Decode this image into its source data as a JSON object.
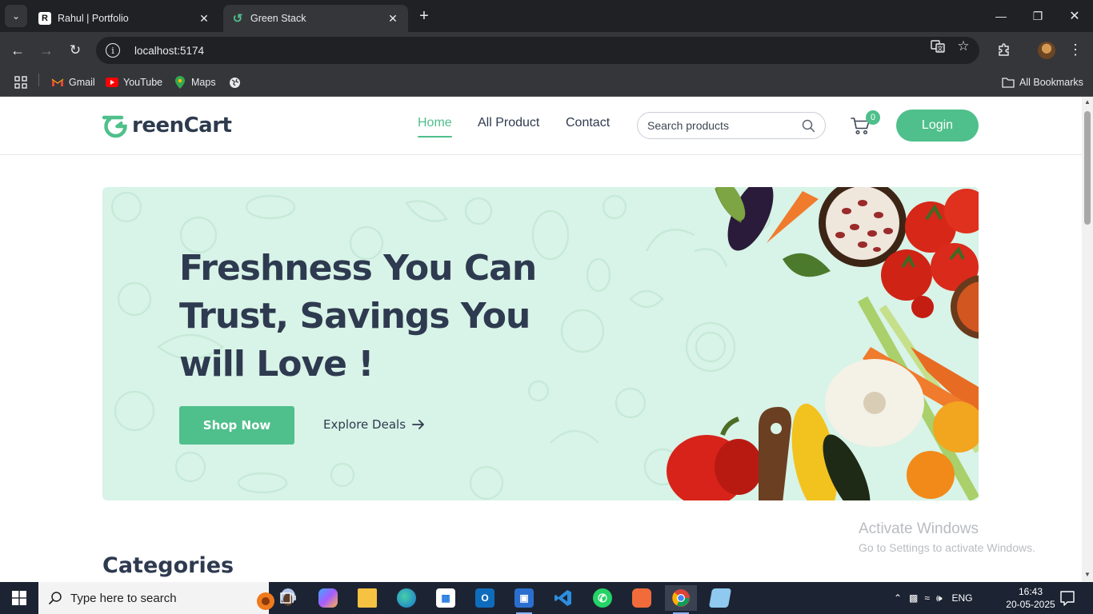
{
  "browser": {
    "tabs": [
      {
        "title": "Rahul | Portfolio",
        "favicon": "R"
      },
      {
        "title": "Green Stack",
        "favicon": "G",
        "active": true
      }
    ],
    "url": "localhost:5174",
    "bookmarks": [
      {
        "label": "Gmail",
        "icon": "gmail-icon"
      },
      {
        "label": "YouTube",
        "icon": "youtube-icon"
      },
      {
        "label": "Maps",
        "icon": "maps-icon"
      },
      {
        "label": "",
        "icon": "globe-icon"
      }
    ],
    "all_bookmarks_label": "All Bookmarks"
  },
  "site": {
    "logo_rest": "reenCart",
    "nav": [
      {
        "label": "Home",
        "active": true
      },
      {
        "label": "All Product"
      },
      {
        "label": "Contact"
      }
    ],
    "search_placeholder": "Search products",
    "cart_count": "0",
    "login_label": "Login",
    "accent": "#4fbf8b",
    "hero": {
      "title_lines": [
        "Freshness You Can",
        "Trust, Savings You",
        "will Love !"
      ],
      "primary_cta": "Shop Now",
      "secondary_cta": "Explore Deals",
      "background": "#d8f3e7"
    },
    "categories_title": "Categories"
  },
  "watermark": {
    "line1": "Activate Windows",
    "line2": "Go to Settings to activate Windows."
  },
  "taskbar": {
    "search_placeholder": "Type here to search",
    "language": "ENG",
    "time": "16:43",
    "date": "20-05-2025"
  }
}
